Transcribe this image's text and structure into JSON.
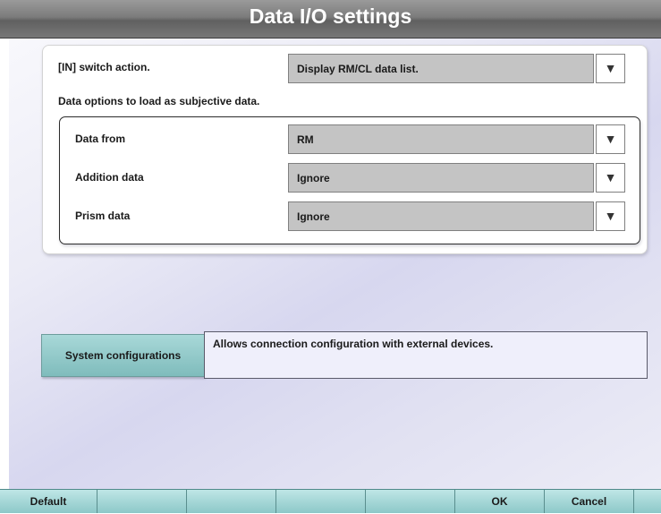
{
  "window": {
    "title": "Data I/O settings"
  },
  "in_switch": {
    "label": "[IN] switch action.",
    "value": "Display RM/CL data list."
  },
  "options_heading": "Data options to load as subjective data.",
  "data_options": [
    {
      "label": "Data from",
      "value": "RM"
    },
    {
      "label": "Addition data",
      "value": "Ignore"
    },
    {
      "label": "Prism data",
      "value": "Ignore"
    }
  ],
  "dropdown_arrow": "▼",
  "system": {
    "button_label": "System configurations",
    "description": "Allows connection configuration with external devices."
  },
  "bottom_bar": {
    "buttons": [
      "Default",
      "",
      "",
      "",
      "",
      "OK",
      "Cancel",
      ""
    ]
  },
  "colors": {
    "title_bar": "#707070",
    "bottom_bar": "#a8d8d8",
    "select_bg": "#c4c4c4"
  }
}
